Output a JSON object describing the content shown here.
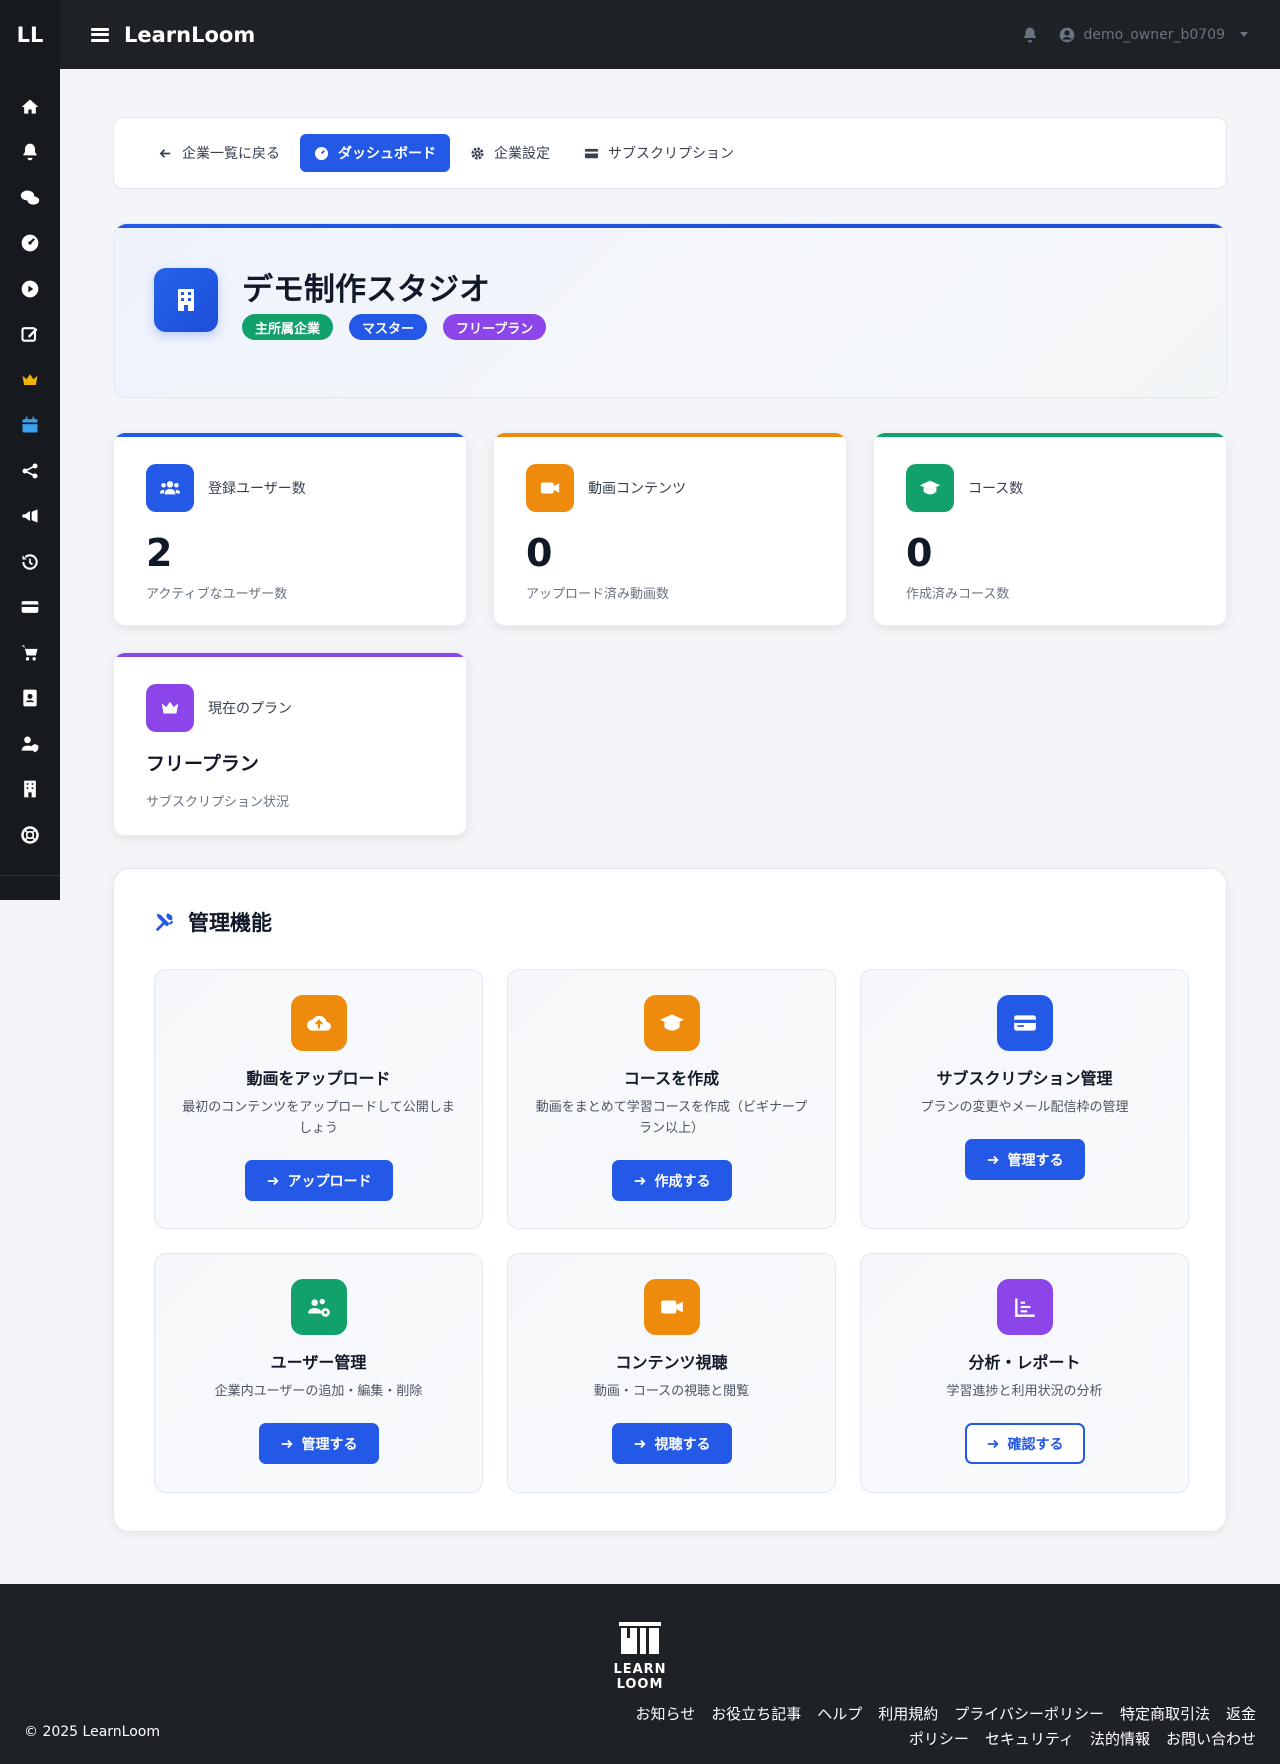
{
  "app": {
    "logo_short": "LL",
    "brand": "LearnLoom",
    "username": "demo_owner_b0709"
  },
  "sidebar": {
    "items": [
      {
        "icon": "home-icon"
      },
      {
        "icon": "bell-icon"
      },
      {
        "icon": "chat-icon"
      },
      {
        "icon": "dashboard-icon"
      },
      {
        "icon": "play-icon"
      },
      {
        "icon": "edit-icon"
      },
      {
        "icon": "crown-icon",
        "color": "#f2b200"
      },
      {
        "icon": "calendar-icon",
        "color": "#3aa0f0"
      },
      {
        "icon": "share-icon"
      },
      {
        "icon": "megaphone-icon"
      },
      {
        "icon": "history-icon"
      },
      {
        "icon": "credit-card-icon"
      },
      {
        "icon": "cart-icon"
      },
      {
        "icon": "contact-book-icon"
      },
      {
        "icon": "user-shield-icon"
      },
      {
        "icon": "building-icon"
      },
      {
        "icon": "lifebuoy-icon"
      }
    ]
  },
  "subnav": {
    "back": "企業一覧に戻る",
    "dashboard": "ダッシュボード",
    "settings": "企業設定",
    "subscription": "サブスクリプション"
  },
  "company": {
    "name": "デモ制作スタジオ",
    "badges": [
      {
        "label": "主所属企業",
        "color": "#12a06b"
      },
      {
        "label": "マスター",
        "color": "#2458e6"
      },
      {
        "label": "フリープラン",
        "color": "#8b45e8"
      }
    ]
  },
  "stats": [
    {
      "label": "登録ユーザー数",
      "value": "2",
      "sub": "アクティブなユーザー数",
      "color": "#2458e6"
    },
    {
      "label": "動画コンテンツ",
      "value": "0",
      "sub": "アップロード済み動画数",
      "color": "#ee8a0c"
    },
    {
      "label": "コース数",
      "value": "0",
      "sub": "作成済みコース数",
      "color": "#12a06b"
    }
  ],
  "plan": {
    "label": "現在のプラン",
    "name": "フリープラン",
    "sub": "サブスクリプション状況",
    "color": "#8b45e8"
  },
  "admin": {
    "title": "管理機能",
    "features": [
      {
        "title": "動画をアップロード",
        "desc": "最初のコンテンツをアップロードして公開しましょう",
        "button": "アップロード",
        "color": "#ee8a0c"
      },
      {
        "title": "コースを作成",
        "desc": "動画をまとめて学習コースを作成（ビギナープラン以上）",
        "button": "作成する",
        "color": "#ee8a0c"
      },
      {
        "title": "サブスクリプション管理",
        "desc": "プランの変更やメール配信枠の管理",
        "button": "管理する",
        "color": "#2458e6"
      },
      {
        "title": "ユーザー管理",
        "desc": "企業内ユーザーの追加・編集・削除",
        "button": "管理する",
        "color": "#12a06b"
      },
      {
        "title": "コンテンツ視聴",
        "desc": "動画・コースの視聴と閲覧",
        "button": "視聴する",
        "color": "#ee8a0c"
      },
      {
        "title": "分析・レポート",
        "desc": "学習進捗と利用状況の分析",
        "button": "確認する",
        "color": "#8b45e8"
      }
    ]
  },
  "footer": {
    "logo_text": "LEARN LOOM",
    "copyright": "© 2025 LearnLoom",
    "links": [
      "お知らせ",
      "お役立ち記事",
      "ヘルプ",
      "利用規約",
      "プライバシーポリシー",
      "特定商取引法",
      "返金ポリシー",
      "セキュリティ",
      "法的情報",
      "お問い合わせ"
    ]
  }
}
